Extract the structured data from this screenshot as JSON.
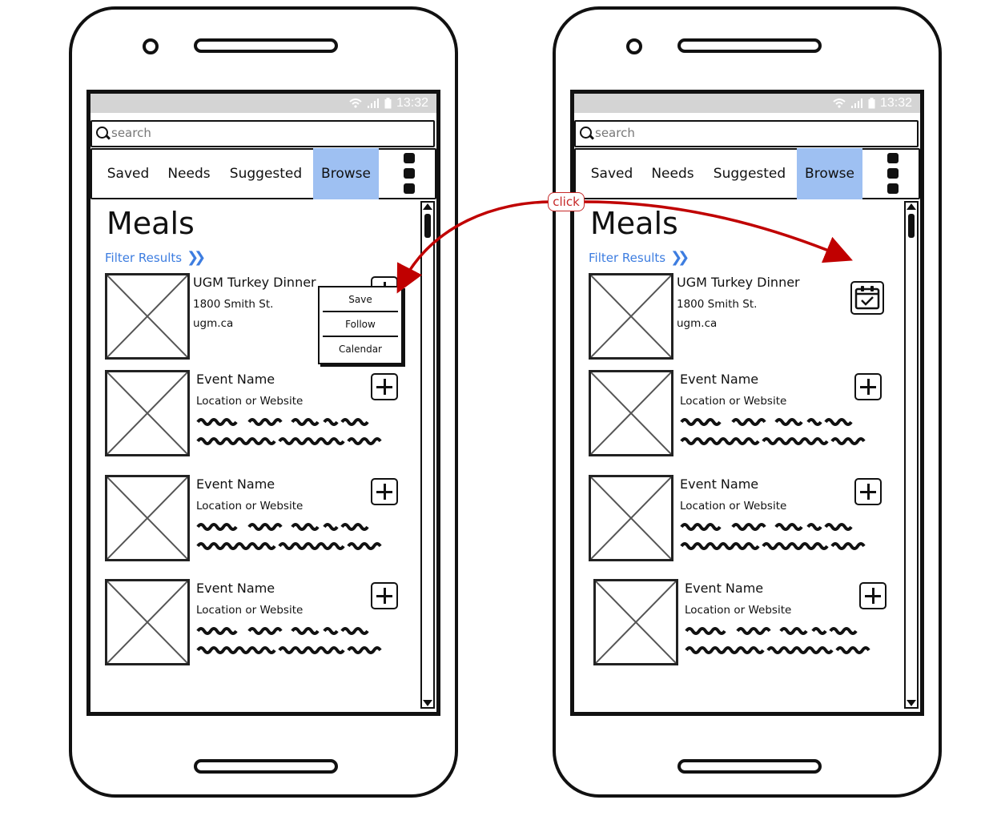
{
  "annotation": {
    "click_label": "click",
    "arrow_color": "#c00000"
  },
  "colors": {
    "tab_active": "#9ec0f2",
    "link": "#3d7de0",
    "statusbar": "#d4d4d4"
  },
  "phones": [
    {
      "status": {
        "time": "13:32",
        "icons": [
          "wifi-icon",
          "signal-icon",
          "battery-icon"
        ]
      },
      "search": {
        "placeholder": "search"
      },
      "tabs": [
        {
          "label": "Saved",
          "active": false
        },
        {
          "label": "Needs",
          "active": false
        },
        {
          "label": "Suggested",
          "active": false
        },
        {
          "label": "Browse",
          "active": true
        }
      ],
      "page_title": "Meals",
      "filter_label": "Filter Results",
      "popup": {
        "items": [
          "Save",
          "Follow",
          "Calendar"
        ]
      },
      "cards": [
        {
          "title": "UGM Turkey Dinner",
          "line1": "1800 Smith St.",
          "line2": "ugm.ca",
          "action": "plus"
        },
        {
          "title": "Event Name",
          "line1": "Location or Website",
          "action": "plus"
        },
        {
          "title": "Event Name",
          "line1": "Location or Website",
          "action": "plus"
        },
        {
          "title": "Event Name",
          "line1": "Location or Website",
          "action": "plus"
        }
      ]
    },
    {
      "status": {
        "time": "13:32",
        "icons": [
          "wifi-icon",
          "signal-icon",
          "battery-icon"
        ]
      },
      "search": {
        "placeholder": "search"
      },
      "tabs": [
        {
          "label": "Saved",
          "active": false
        },
        {
          "label": "Needs",
          "active": false
        },
        {
          "label": "Suggested",
          "active": false
        },
        {
          "label": "Browse",
          "active": true
        }
      ],
      "page_title": "Meals",
      "filter_label": "Filter Results",
      "cards": [
        {
          "title": "UGM Turkey Dinner",
          "line1": "1800 Smith St.",
          "line2": "ugm.ca",
          "action": "calendar-check"
        },
        {
          "title": "Event Name",
          "line1": "Location or Website",
          "action": "plus"
        },
        {
          "title": "Event Name",
          "line1": "Location or Website",
          "action": "plus"
        },
        {
          "title": "Event Name",
          "line1": "Location or Website",
          "action": "plus"
        }
      ]
    }
  ]
}
